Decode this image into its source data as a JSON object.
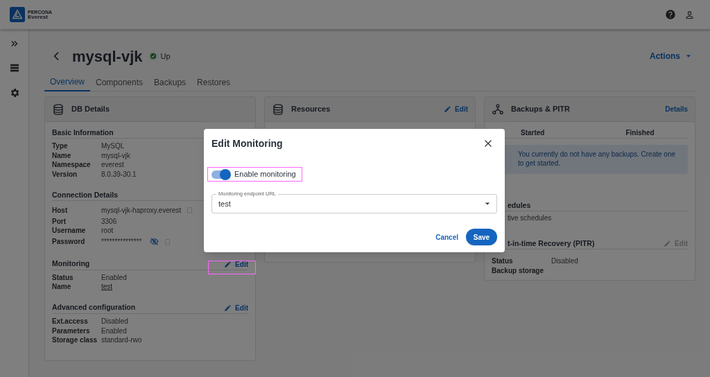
{
  "header": {
    "brand_top": "PERCONA",
    "brand_bottom": "Everest"
  },
  "page": {
    "title": "mysql-vjk",
    "status": "Up",
    "actions": "Actions"
  },
  "tabs": [
    {
      "label": "Overview",
      "selected": true
    },
    {
      "label": "Components",
      "selected": false
    },
    {
      "label": "Backups",
      "selected": false
    },
    {
      "label": "Restores",
      "selected": false
    }
  ],
  "db_details": {
    "title": "DB Details",
    "sections": [
      {
        "title": "Basic Information",
        "rows": [
          {
            "label": "Type",
            "value": "MySQL",
            "kind": "text"
          },
          {
            "label": "Name",
            "value": "mysql-vjk",
            "kind": "text"
          },
          {
            "label": "Namespace",
            "value": "everest",
            "kind": "text"
          },
          {
            "label": "Version",
            "value": "8.0.39-30.1",
            "kind": "text"
          }
        ]
      },
      {
        "title": "Connection Details",
        "rows": [
          {
            "label": "Host",
            "value": "mysql-vjk-haproxy.everest",
            "kind": "copy"
          },
          {
            "label": "Port",
            "value": "3306",
            "kind": "text"
          },
          {
            "label": "Username",
            "value": "root",
            "kind": "text"
          },
          {
            "label": "Password",
            "value": "***************",
            "kind": "secret"
          }
        ]
      },
      {
        "title": "Monitoring",
        "edit": "Edit",
        "rows": [
          {
            "label": "Status",
            "value": "Enabled",
            "kind": "text"
          },
          {
            "label": "Name",
            "value": "test",
            "kind": "link"
          }
        ]
      },
      {
        "title": "Advanced configuration",
        "edit": "Edit",
        "rows": [
          {
            "label": "Ext.access",
            "value": "Disabled",
            "kind": "text"
          },
          {
            "label": "Parameters",
            "value": "Enabled",
            "kind": "text"
          },
          {
            "label": "Storage class",
            "value": "standard-rwo",
            "kind": "text"
          }
        ]
      }
    ]
  },
  "resources": {
    "title": "Resources",
    "edit": "Edit"
  },
  "backups": {
    "title": "Backups & PITR",
    "details": "Details",
    "columns": [
      "Started",
      "Finished"
    ],
    "alert": "You currently do not have any backups. Create one to get started.",
    "schedules_title": "edules",
    "schedules_text": "tive schedules",
    "pitr": {
      "title": "t-in-time Recovery (PITR)",
      "edit": "Edit",
      "disabled": true,
      "rows": [
        {
          "label": "Status",
          "value": "Disabled"
        },
        {
          "label": "Backup storage",
          "value": ""
        }
      ]
    }
  },
  "modal": {
    "title": "Edit Monitoring",
    "toggle": {
      "label": "Enable monitoring",
      "on": true
    },
    "select": {
      "label": "Monitoring endpoint URL",
      "value": "test"
    },
    "cancel": "Cancel",
    "save": "Save"
  }
}
